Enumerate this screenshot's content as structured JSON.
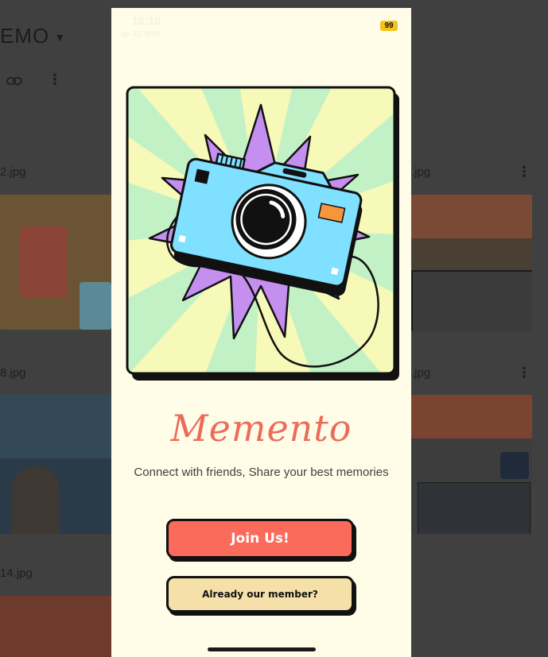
{
  "background": {
    "folder_title": "EMO",
    "files": [
      {
        "name": "2.jpg"
      },
      {
        "name": ".jpg"
      },
      {
        "name": "8.jpg"
      },
      {
        "name": ".jpg"
      },
      {
        "name": "14.jpg"
      }
    ]
  },
  "status_bar": {
    "time": "10:10",
    "subtext": "ab 4G 85% ·",
    "battery": "99"
  },
  "app": {
    "title": "Memento",
    "tagline": "Connect with friends, Share your best memories",
    "join_label": "Join Us!",
    "member_label": "Already our member?"
  },
  "colors": {
    "screen_bg": "#fffde8",
    "accent": "#fb6b5c",
    "secondary_button": "#f4e0a8",
    "camera_body": "#7fe0ff",
    "burst": "#c58ff0"
  },
  "icons": {
    "hero": "camera-illustration",
    "link": "link-icon",
    "more": "kebab-icon"
  }
}
